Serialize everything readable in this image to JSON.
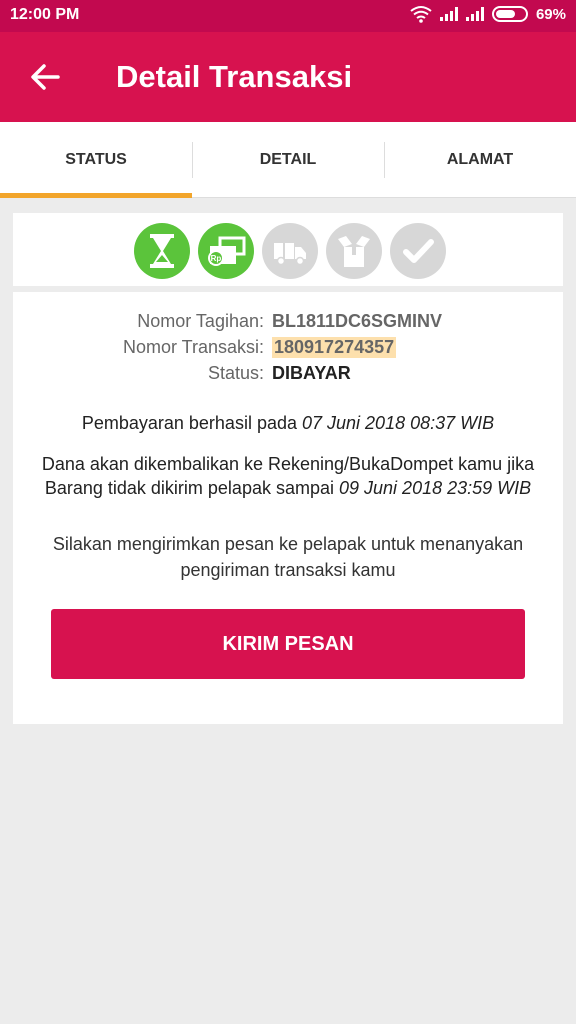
{
  "status_bar": {
    "time": "12:00 PM",
    "battery": "69%",
    "battery_level": 0.69
  },
  "app_bar": {
    "title": "Detail Transaksi",
    "back_icon": "arrow-left-icon"
  },
  "tabs": [
    {
      "label": "STATUS",
      "active": true
    },
    {
      "label": "DETAIL",
      "active": false
    },
    {
      "label": "ALAMAT",
      "active": false
    }
  ],
  "steps": [
    {
      "icon": "hourglass-icon",
      "done": true
    },
    {
      "icon": "payment-rp-icon",
      "done": true
    },
    {
      "icon": "truck-icon",
      "done": false
    },
    {
      "icon": "package-icon",
      "done": false
    },
    {
      "icon": "checkmark-icon",
      "done": false
    }
  ],
  "info": {
    "tagihan_label": "Nomor Tagihan:",
    "tagihan_value": "BL1811DC6SGMINV",
    "transaksi_label": "Nomor Transaksi:",
    "transaksi_value": "180917274357",
    "status_label": "Status:",
    "status_value": "DIBAYAR"
  },
  "messages": {
    "payment_prefix": "Pembayaran berhasil pada",
    "payment_date": "07 Juni 2018 08:37 WIB",
    "refund_line1": "Dana akan dikembalikan ke Rekening/BukaDompet kamu jika",
    "refund_line2_prefix": "Barang tidak dikirim pelapak sampai",
    "refund_date": "09 Juni 2018 23:59 WIB",
    "contact_line1": "Silakan mengirimkan pesan ke pelapak untuk menanyakan",
    "contact_line2": "pengiriman transaksi kamu"
  },
  "button": {
    "label": "KIRIM PESAN"
  },
  "colors": {
    "status_bar": "#c2094f",
    "primary": "#d7124f",
    "tab_indicator": "#f2a52b",
    "step_done": "#5bc43b",
    "step_todo": "#d7d7d7",
    "highlight": "#fde0ad"
  }
}
